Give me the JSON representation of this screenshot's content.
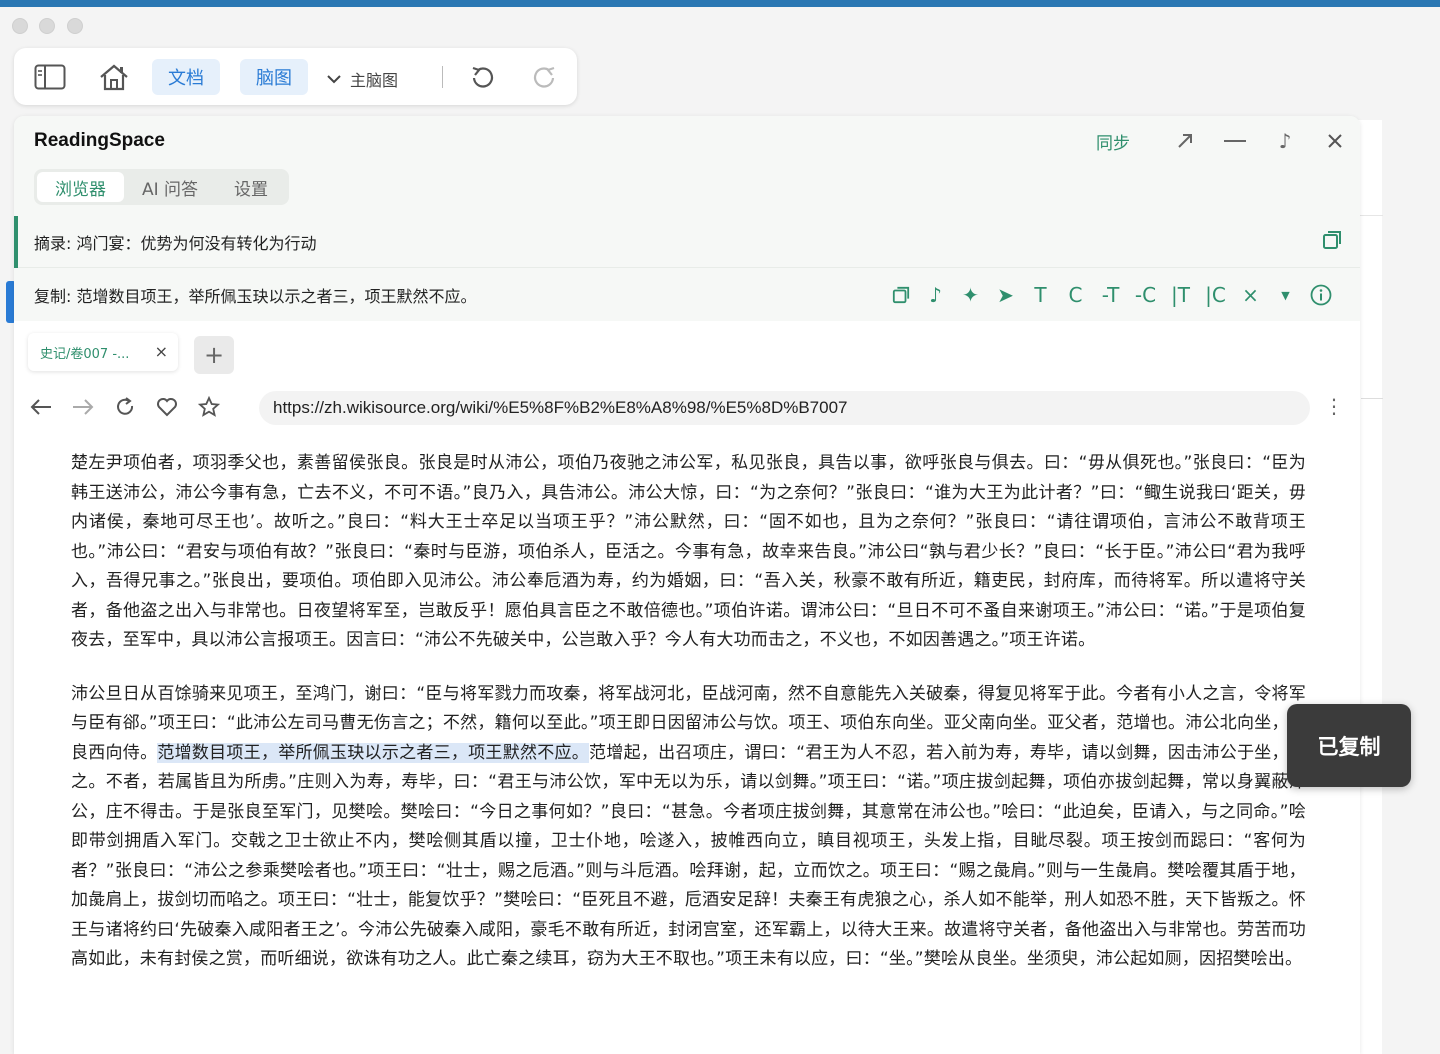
{
  "toolbar": {
    "doc_label": "文档",
    "mindmap_label": "脑图",
    "main_mindmap_label": "主脑图"
  },
  "panel": {
    "title": "ReadingSpace",
    "sync_label": "同步",
    "tabs": [
      {
        "label": "浏览器"
      },
      {
        "label": "AI 问答"
      },
      {
        "label": "设置"
      }
    ],
    "excerpt": "摘录: 鸿门宴：优势为何没有转化为行动",
    "copy": "复制: 范增数目项王，举所佩玉玦以示之者三，项王默然不应。",
    "tool_labels": [
      "T",
      "C",
      "-T",
      "-C",
      "|T",
      "|C"
    ]
  },
  "browser": {
    "tab_title": "史记/卷007 -...",
    "url": "https://zh.wikisource.org/wiki/%E5%8F%B2%E8%A8%98/%E5%8D%B7007"
  },
  "article": {
    "p1": "楚左尹项伯者，项羽季父也，素善留侯张良。张良是时从沛公，项伯乃夜驰之沛公军，私见张良，具告以事，欲呼张良与俱去。曰：“毋从俱死也。”张良曰：“臣为韩王送沛公，沛公今事有急，亡去不义，不可不语。”良乃入，具告沛公。沛公大惊，曰：“为之奈何？”张良曰：“谁为大王为此计者？”曰：“鲰生说我曰‘距关，毋内诸侯，秦地可尽王也’。故听之。”良曰：“料大王士卒足以当项王乎？”沛公默然，曰：“固不如也，且为之奈何？”张良曰：“请往谓项伯，言沛公不敢背项王也。”沛公曰：“君安与项伯有故？”张良曰：“秦时与臣游，项伯杀人，臣活之。今事有急，故幸来告良。”沛公曰“孰与君少长？”良曰：“长于臣。”沛公曰“君为我呼入，吾得兄事之。”张良出，要项伯。项伯即入见沛公。沛公奉卮酒为寿，约为婚姻，曰：“吾入关，秋豪不敢有所近，籍吏民，封府库，而待将军。所以遣将守关者，备他盗之出入与非常也。日夜望将军至，岂敢反乎！愿伯具言臣之不敢倍德也。”项伯许诺。谓沛公曰：“旦日不可不蚤自来谢项王。”沛公曰：“诺。”于是项伯复夜去，至军中，具以沛公言报项王。因言曰：“沛公不先破关中，公岂敢入乎？今人有大功而击之，不义也，不如因善遇之。”项王许诺。",
    "p2_before": "沛公旦日从百馀骑来见项王，至鸿门，谢曰：“臣与将军戮力而攻秦，将军战河北，臣战河南，然不自意能先入关破秦，得复见将军于此。今者有小人之言，令将军与臣有郤。”项王曰：“此沛公左司马曹无伤言之；不然，籍何以至此。”项王即日因留沛公与饮。项王、项伯东向坐。亚父南向坐。亚父者，范增也。沛公北向坐，张良西向侍。",
    "p2_highlight": "范增数目项王，举所佩玉玦以示之者三，项王默然不应。",
    "p2_after": "范增起，出召项庄，谓曰：“君王为人不忍，若入前为寿，寿毕，请以剑舞，因击沛公于坐，杀之。不者，若属皆且为所虏。”庄则入为寿，寿毕，曰：“君王与沛公饮，军中无以为乐，请以剑舞。”项王曰：“诺。”项庄拔剑起舞，项伯亦拔剑起舞，常以身翼蔽沛公，庄不得击。于是张良至军门，见樊哙。樊哙曰：“今日之事何如？”良曰：“甚急。今者项庄拔剑舞，其意常在沛公也。”哙曰：“此迫矣，臣请入，与之同命。”哙即带剑拥盾入军门。交戟之卫士欲止不内，樊哙侧其盾以撞，卫士仆地，哙遂入，披帷西向立，瞋目视项王，头发上指，目眦尽裂。项王按剑而跽曰：“客何为者？”张良曰：“沛公之参乘樊哙者也。”项王曰：“壮士，赐之卮酒。”则与斗卮酒。哙拜谢，起，立而饮之。项王曰：“赐之彘肩。”则与一生彘肩。樊哙覆其盾于地，加彘肩上，拔剑切而啗之。项王曰：“壮士，能复饮乎？”樊哙曰：“臣死且不避，卮酒安足辞！夫秦王有虎狼之心，杀人如不能举，刑人如恐不胜，天下皆叛之。怀王与诸将约曰‘先破秦入咸阳者王之’。今沛公先破秦入咸阳，豪毛不敢有所近，封闭宫室，还军霸上，以待大王来。故遣将守关者，备他盗出入与非常也。劳苦而功高如此，未有封侯之赏，而听细说，欲诛有功之人。此亡秦之续耳，窃为大王不取也。”项王未有以应，曰：“坐。”樊哙从良坐。坐须臾，沛公起如厕，因招樊哙出。"
  },
  "toast": "已复制",
  "colors": {
    "accent_green": "#2f8f6d",
    "accent_blue": "#2a7bd5",
    "highlight": "#dbe7f7",
    "toast_bg": "#3b3b3b"
  },
  "icons": [
    "sidebar-icon",
    "home-icon",
    "chevron-down-icon",
    "undo-icon",
    "redo-icon",
    "expand-icon",
    "minimize-icon",
    "music-note-icon",
    "close-icon",
    "copy-icon",
    "sparkle-icon",
    "send-icon",
    "caret-down-icon",
    "info-icon",
    "back-arrow-icon",
    "forward-arrow-icon",
    "reload-icon",
    "heart-icon",
    "star-icon",
    "kebab-menu-icon",
    "plus-icon"
  ]
}
